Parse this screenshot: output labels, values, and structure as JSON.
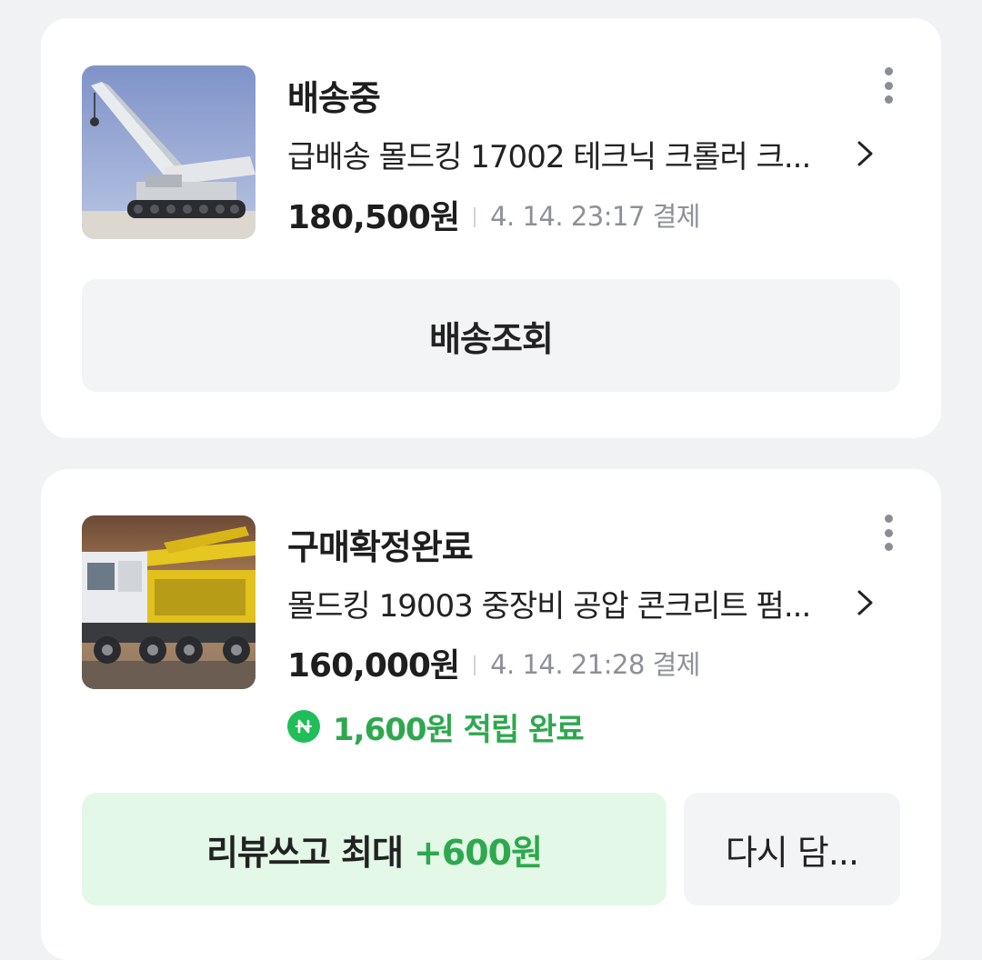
{
  "orders": [
    {
      "status": "배송중",
      "product_name": "급배송 몰드킹 17002 테크닉 크롤러 크...",
      "price": "180,500원",
      "paid_at": "4. 14. 23:17 결제",
      "thumbnail_icon": "crawler-crane-photo",
      "action_button": "배송조회"
    },
    {
      "status": "구매확정완료",
      "product_name": "몰드킹 19003 중장비 공압 콘크리트 펌...",
      "price": "160,000원",
      "paid_at": "4. 14. 21:28 결제",
      "thumbnail_icon": "concrete-pump-truck-photo",
      "reward_icon": "npay-point-icon",
      "reward_text": "1,600원 적립 완료",
      "review_button": {
        "label": "리뷰쓰고 최대",
        "accent": "+600원"
      },
      "recart_button": "다시 담..."
    }
  ],
  "colors": {
    "background": "#f1f2f4",
    "card": "#ffffff",
    "accent_green": "#2ea84f",
    "review_button_bg": "#e3f8e6",
    "neutral_button_bg": "#f3f4f6"
  }
}
